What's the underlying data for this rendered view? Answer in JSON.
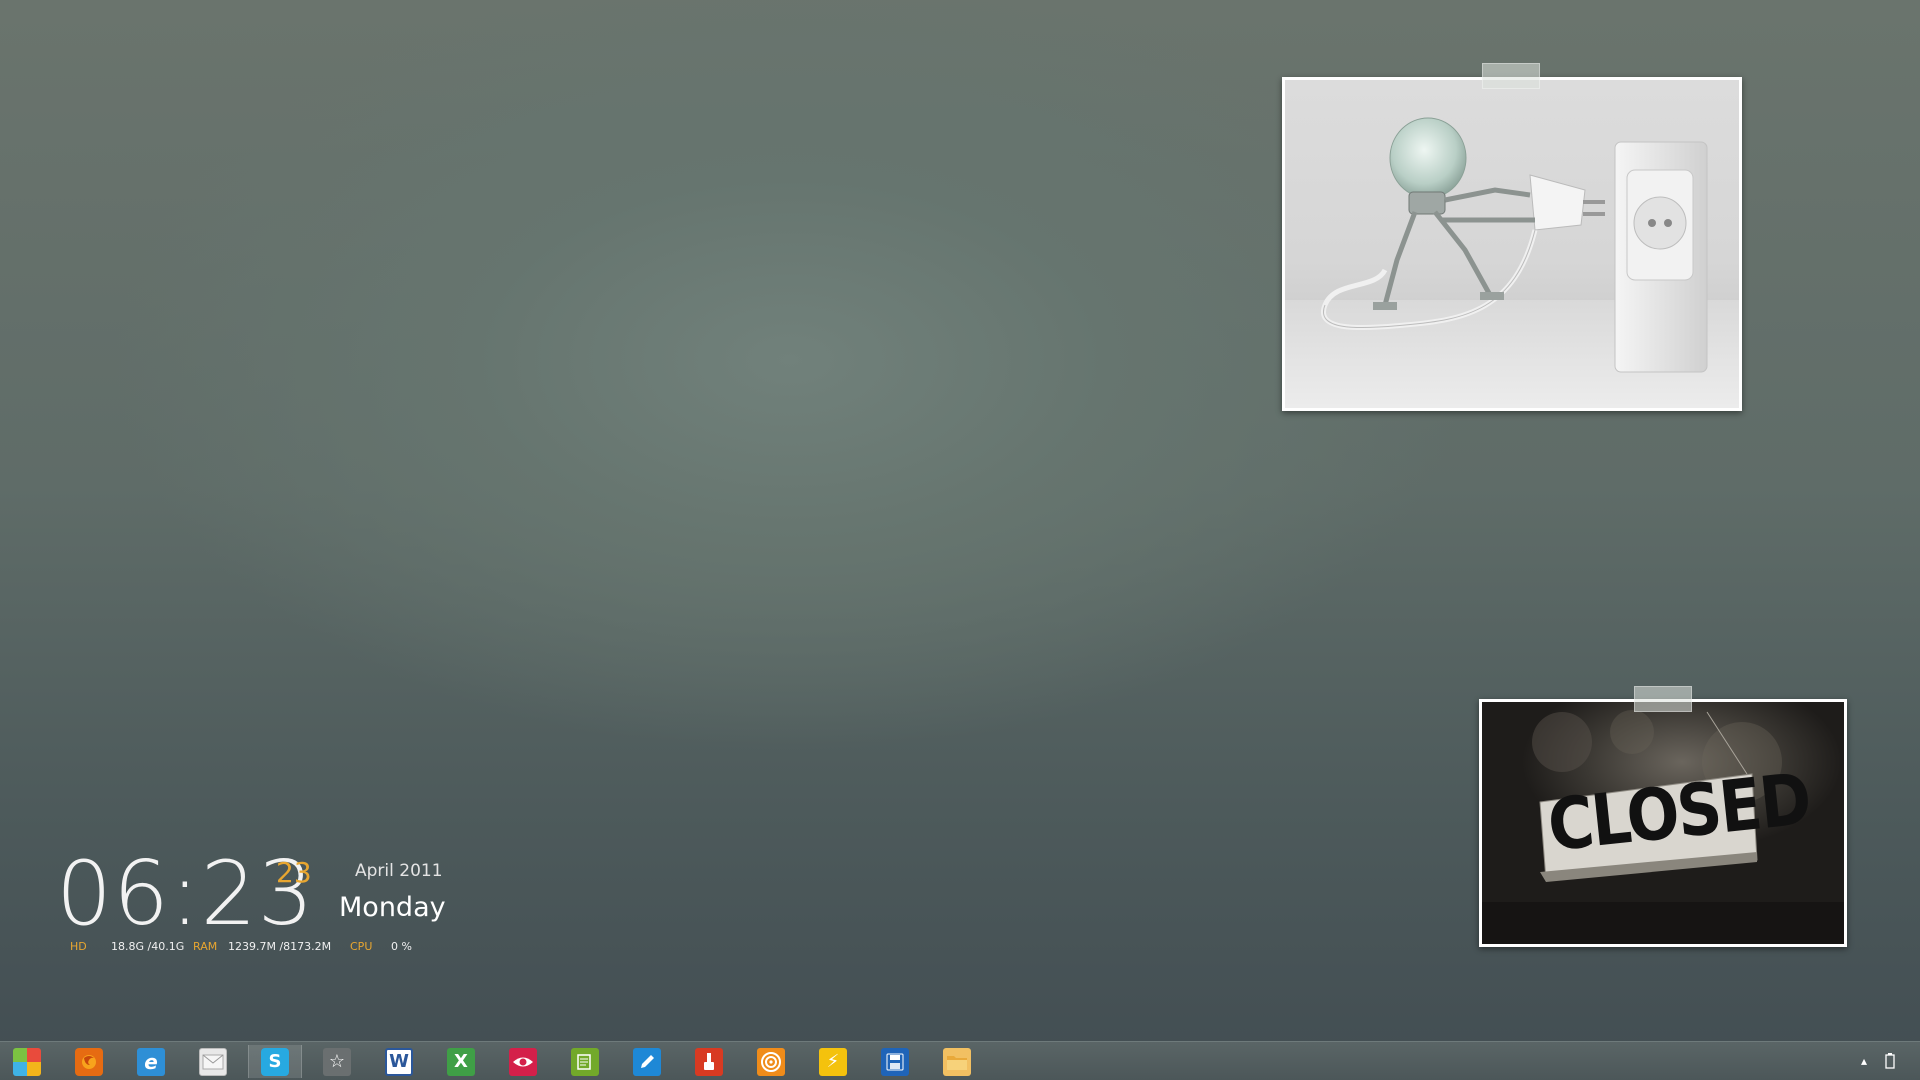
{
  "clock": {
    "time": "06:23",
    "day": "23",
    "month_year": "April 2011",
    "weekday": "Monday"
  },
  "stats": {
    "hd_label": "HD",
    "hd_value": "18.8G /40.1G",
    "ram_label": "RAM",
    "ram_value": "1239.7M /8173.2M",
    "cpu_label": "CPU",
    "cpu_value": "0 %"
  },
  "photos": {
    "closed_sign_text": "CLOSED"
  },
  "taskbar": {
    "icons": [
      {
        "name": "start-icon",
        "glyph": ""
      },
      {
        "name": "firefox-icon",
        "glyph": ""
      },
      {
        "name": "internet-explorer-icon",
        "glyph": "e"
      },
      {
        "name": "mail-icon",
        "glyph": ""
      },
      {
        "name": "skype-icon",
        "glyph": "S"
      },
      {
        "name": "favorites-icon",
        "glyph": "☆"
      },
      {
        "name": "word-icon",
        "glyph": "W"
      },
      {
        "name": "excel-icon",
        "glyph": "X"
      },
      {
        "name": "eye-icon",
        "glyph": ""
      },
      {
        "name": "notepadpp-icon",
        "glyph": ""
      },
      {
        "name": "pen-editor-icon",
        "glyph": ""
      },
      {
        "name": "paint-brush-icon",
        "glyph": ""
      },
      {
        "name": "target-icon",
        "glyph": ""
      },
      {
        "name": "lightning-icon",
        "glyph": "⚡"
      },
      {
        "name": "save-disk-icon",
        "glyph": ""
      },
      {
        "name": "folder-icon",
        "glyph": ""
      }
    ],
    "colors": {
      "accent": "#e8a630",
      "word": "#2b579a",
      "excel": "#3f9f46",
      "skype": "#27a9e1",
      "ie": "#2e8fd6",
      "firefox": "#e66b12"
    }
  }
}
